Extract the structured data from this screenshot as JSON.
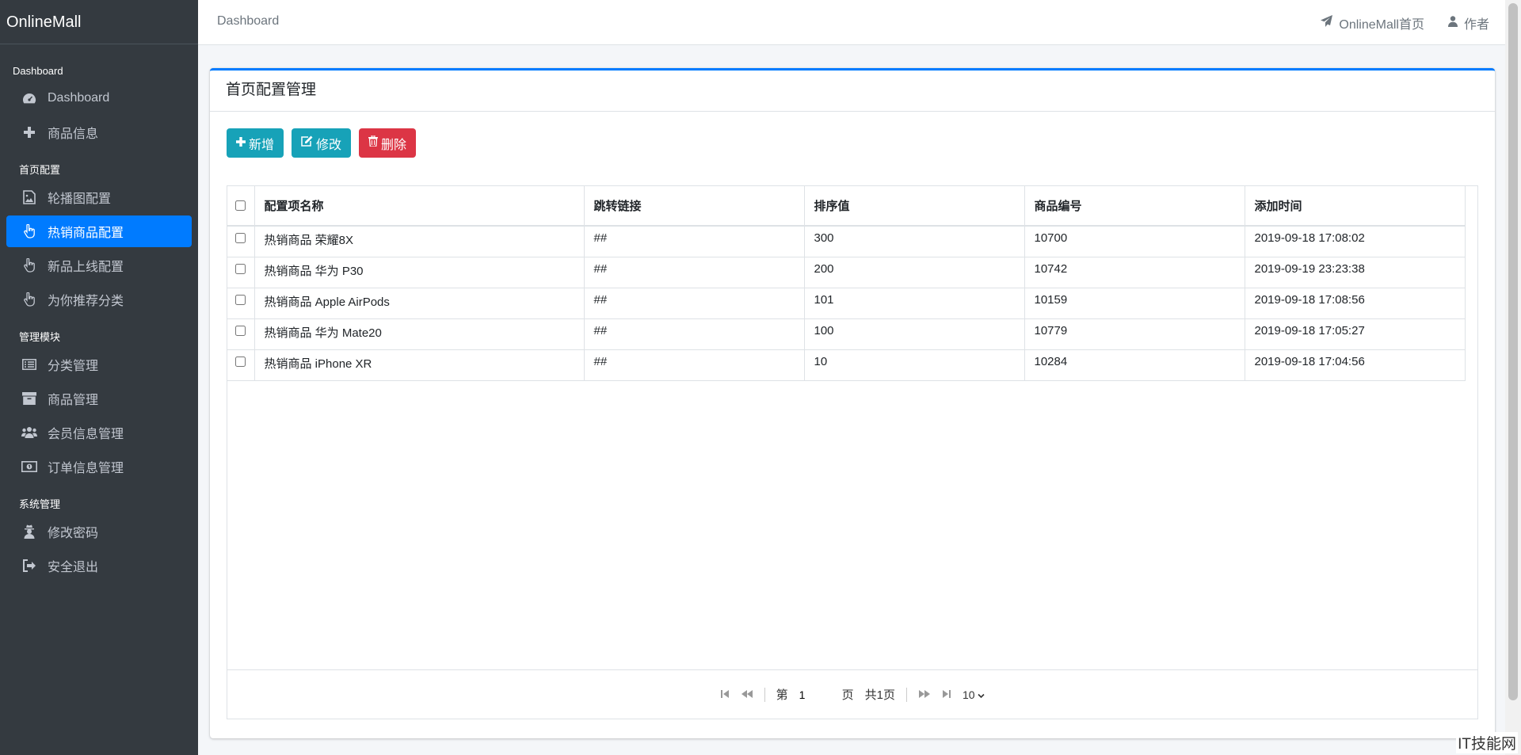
{
  "brand": "OnlineMall",
  "sidebar": {
    "groups": [
      {
        "header": "Dashboard",
        "items": [
          {
            "label": "Dashboard",
            "icon": "dashboard-icon"
          },
          {
            "label": "商品信息",
            "icon": "plus-icon"
          }
        ]
      },
      {
        "header": "首页配置",
        "items": [
          {
            "label": "轮播图配置",
            "icon": "image-icon"
          },
          {
            "label": "热销商品配置",
            "icon": "pointer-hand-icon",
            "active": true
          },
          {
            "label": "新品上线配置",
            "icon": "pointer-hand-icon"
          },
          {
            "label": "为你推荐分类",
            "icon": "pointer-hand-icon"
          }
        ]
      },
      {
        "header": "管理模块",
        "items": [
          {
            "label": "分类管理",
            "icon": "list-icon"
          },
          {
            "label": "商品管理",
            "icon": "archive-icon"
          },
          {
            "label": "会员信息管理",
            "icon": "users-icon"
          },
          {
            "label": "订单信息管理",
            "icon": "money-icon"
          }
        ]
      },
      {
        "header": "系统管理",
        "items": [
          {
            "label": "修改密码",
            "icon": "user-secret-icon"
          },
          {
            "label": "安全退出",
            "icon": "sign-out-icon"
          }
        ]
      }
    ]
  },
  "topbar": {
    "breadcrumb": "Dashboard",
    "home_link": "OnlineMall首页",
    "author_link": "作者"
  },
  "card": {
    "title": "首页配置管理",
    "buttons": {
      "add": "新增",
      "edit": "修改",
      "delete": "删除"
    }
  },
  "table": {
    "headers": [
      "配置项名称",
      "跳转链接",
      "排序值",
      "商品编号",
      "添加时间"
    ],
    "rows": [
      [
        "热销商品 荣耀8X",
        "##",
        "300",
        "10700",
        "2019-09-18 17:08:02"
      ],
      [
        "热销商品 华为 P30",
        "##",
        "200",
        "10742",
        "2019-09-19 23:23:38"
      ],
      [
        "热销商品 Apple AirPods",
        "##",
        "101",
        "10159",
        "2019-09-18 17:08:56"
      ],
      [
        "热销商品 华为 Mate20",
        "##",
        "100",
        "10779",
        "2019-09-18 17:05:27"
      ],
      [
        "热销商品 iPhone XR",
        "##",
        "10",
        "10284",
        "2019-09-18 17:04:56"
      ]
    ]
  },
  "pager": {
    "prefix": "第",
    "page": "1",
    "suffix": "页",
    "total": "共1页",
    "page_size": "10"
  },
  "watermark": "IT技能网",
  "colors": {
    "sidebar_bg": "#343a40",
    "accent": "#007bff",
    "info": "#17a2b8",
    "danger": "#dc3545"
  }
}
